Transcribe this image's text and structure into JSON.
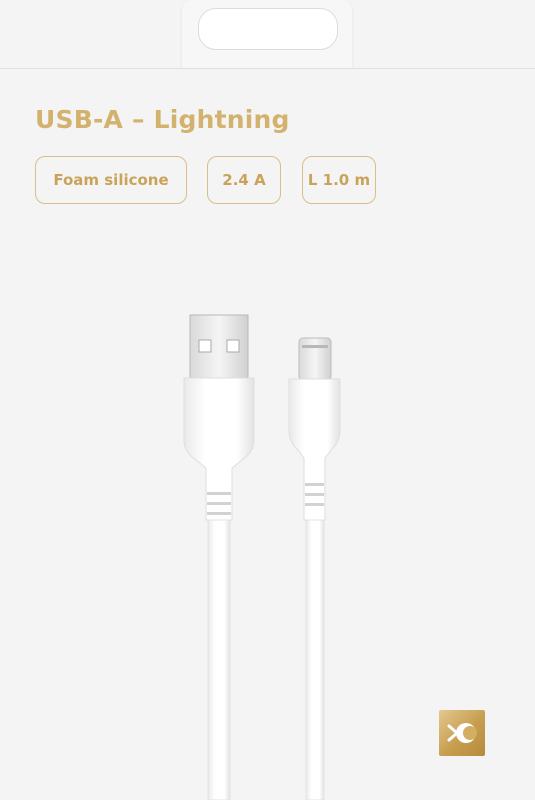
{
  "product": {
    "title": "USB-A – Lightning",
    "badges": [
      "Foam silicone",
      "2.4 A",
      "L 1.0 m"
    ]
  },
  "colors": {
    "accent_gold": "#d3b26e",
    "background": "#f4f4f4",
    "cable": "#ffffff"
  },
  "icons": {
    "logo": "brand-logo-icon"
  }
}
